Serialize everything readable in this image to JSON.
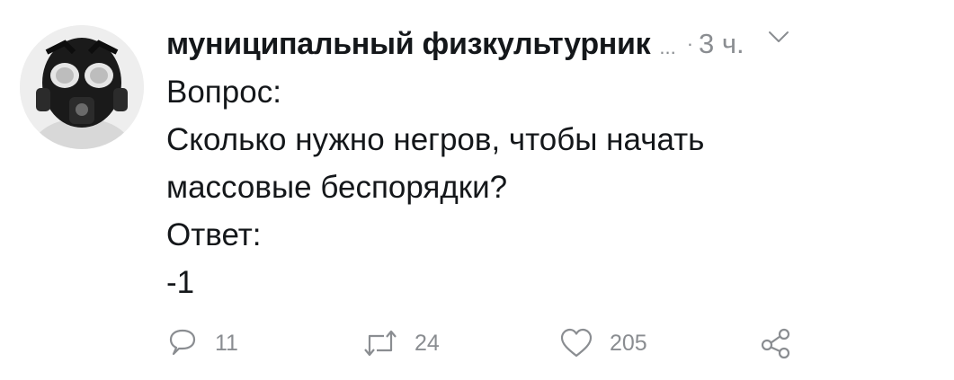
{
  "tweet": {
    "author": {
      "display_name": "муниципальный физкультурник",
      "name_truncation": "...",
      "avatar_icon": "gas-mask-avatar"
    },
    "separator": "·",
    "time": "3 ч.",
    "menu_icon": "chevron-down-icon",
    "lines": [
      "Вопрос:",
      "Сколько нужно негров, чтобы начать",
      "массовые беспорядки?",
      "Ответ:",
      "-1"
    ],
    "actions": {
      "reply": {
        "icon": "reply-icon",
        "count": "11"
      },
      "retweet": {
        "icon": "retweet-icon",
        "count": "24"
      },
      "like": {
        "icon": "heart-icon",
        "count": "205"
      },
      "share": {
        "icon": "share-icon"
      }
    },
    "colors": {
      "text": "#14171a",
      "secondary": "#8a8d91"
    }
  }
}
